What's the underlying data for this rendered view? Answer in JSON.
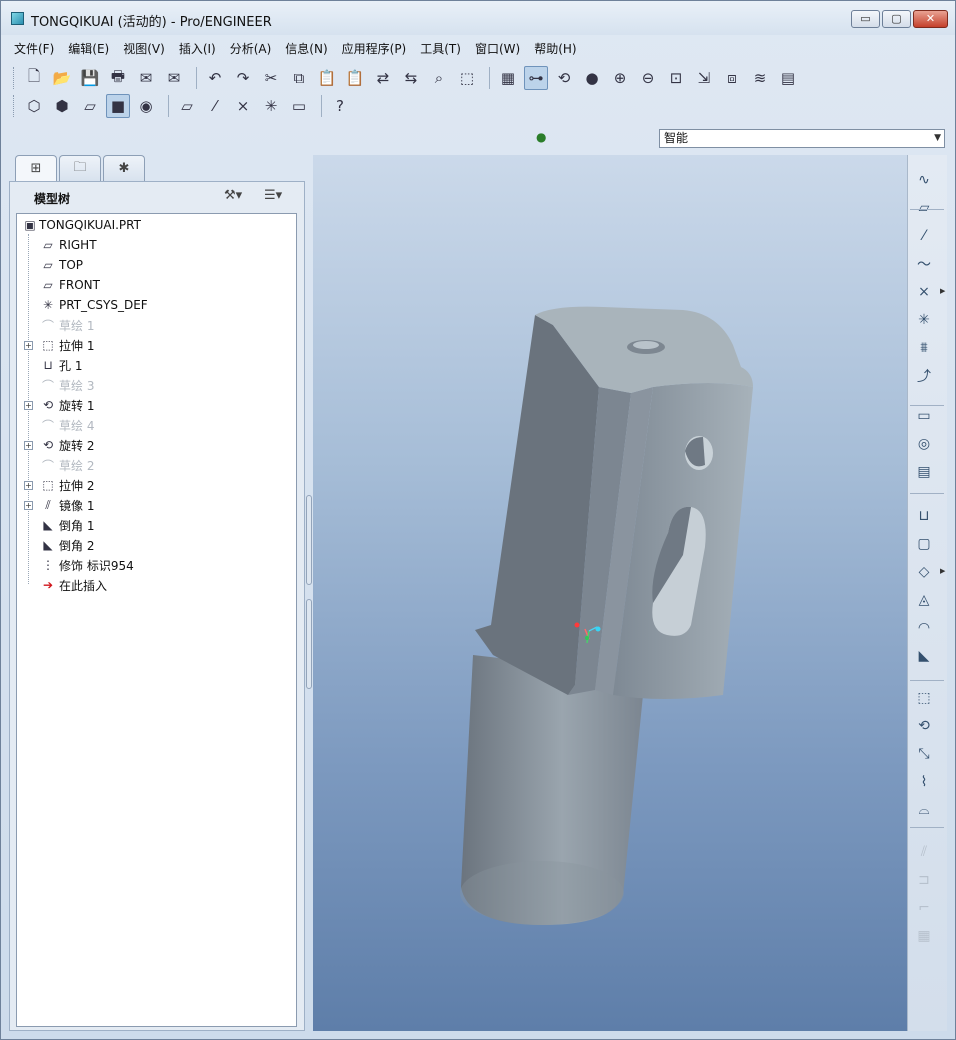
{
  "window": {
    "title": "TONGQIKUAI (活动的) - Pro/ENGINEER",
    "controls": {
      "minimize": "▭",
      "maximize": "▢",
      "close": "✕"
    }
  },
  "menu": [
    "文件(F)",
    "编辑(E)",
    "视图(V)",
    "插入(I)",
    "分析(A)",
    "信息(N)",
    "应用程序(P)",
    "工具(T)",
    "窗口(W)",
    "帮助(H)"
  ],
  "toolbar": {
    "row1": [
      "new-file",
      "open-file",
      "save",
      "print",
      "send-mail",
      "send-mail-2",
      "undo",
      "redo",
      "cut",
      "copy",
      "paste",
      "paste-special",
      "regenerate",
      "regenerate-manager",
      "find",
      "select-box",
      "repaint",
      "spin-center",
      "orient-mode",
      "appearance",
      "zoom-in",
      "zoom-out",
      "refit",
      "reorient",
      "saved-views",
      "layers",
      "view-manager"
    ],
    "row2": [
      "wireframe",
      "hidden-line",
      "no-hidden",
      "shading",
      "enhanced-realism",
      "datum-planes",
      "datum-axes",
      "datum-points",
      "coordinate-systems",
      "annotations",
      "context-help"
    ]
  },
  "filter": {
    "value": "智能"
  },
  "navigator": {
    "tabs": [
      "model-tree-tab",
      "folder-browser-tab",
      "favorites-tab"
    ],
    "title": "模型树",
    "tree": [
      {
        "label": "TONGQIKUAI.PRT",
        "icon": "part-icon",
        "expand": false,
        "dim": false,
        "root": true
      },
      {
        "label": "RIGHT",
        "icon": "datum-plane-icon",
        "expand": false,
        "dim": false
      },
      {
        "label": "TOP",
        "icon": "datum-plane-icon",
        "expand": false,
        "dim": false
      },
      {
        "label": "FRONT",
        "icon": "datum-plane-icon",
        "expand": false,
        "dim": false
      },
      {
        "label": "PRT_CSYS_DEF",
        "icon": "csys-icon",
        "expand": false,
        "dim": false
      },
      {
        "label": "草绘 1",
        "icon": "sketch-icon",
        "expand": false,
        "dim": true
      },
      {
        "label": "拉伸 1",
        "icon": "extrude-icon",
        "expand": true,
        "dim": false
      },
      {
        "label": "孔 1",
        "icon": "hole-icon",
        "expand": false,
        "dim": false
      },
      {
        "label": "草绘 3",
        "icon": "sketch-icon",
        "expand": false,
        "dim": true
      },
      {
        "label": "旋转 1",
        "icon": "revolve-icon",
        "expand": true,
        "dim": false
      },
      {
        "label": "草绘 4",
        "icon": "sketch-icon",
        "expand": false,
        "dim": true
      },
      {
        "label": "旋转 2",
        "icon": "revolve-icon",
        "expand": true,
        "dim": false
      },
      {
        "label": "草绘 2",
        "icon": "sketch-icon",
        "expand": false,
        "dim": true
      },
      {
        "label": "拉伸 2",
        "icon": "extrude-icon",
        "expand": true,
        "dim": false
      },
      {
        "label": "镜像 1",
        "icon": "mirror-icon",
        "expand": true,
        "dim": false
      },
      {
        "label": "倒角 1",
        "icon": "chamfer-icon",
        "expand": false,
        "dim": false
      },
      {
        "label": "倒角 2",
        "icon": "chamfer-icon",
        "expand": false,
        "dim": false
      },
      {
        "label": "修饰 标识954",
        "icon": "cosmetic-thread-icon",
        "expand": false,
        "dim": false
      },
      {
        "label": "在此插入",
        "icon": "insert-here-icon",
        "expand": false,
        "dim": false
      }
    ]
  },
  "right_toolbar": [
    "sketch-tool",
    "datum-plane-tool",
    "datum-axis-tool",
    "datum-curve-tool",
    "datum-point-tool",
    "csys-tool",
    "analysis-feature-tool",
    "sketched-curve-tool",
    "annotation-tool",
    "surface-finish-tool",
    "datum-target-tool",
    "hole-tool",
    "shell-tool",
    "rib-tool",
    "draft-tool",
    "round-tool",
    "chamfer-tool",
    "extrude-tool",
    "revolve-tool",
    "sweep-tool",
    "blend-tool",
    "boundary-tool",
    "mirror-tool",
    "merge-tool",
    "trim-tool",
    "pattern-tool"
  ],
  "colors": {
    "part": "#8e9aa4",
    "part_light": "#b0bbc3",
    "part_dark": "#666f79",
    "graphics_bg_top": "#cbd9ea",
    "graphics_bg_bottom": "#5e7ea9",
    "insert_arrow": "#d0161c"
  }
}
